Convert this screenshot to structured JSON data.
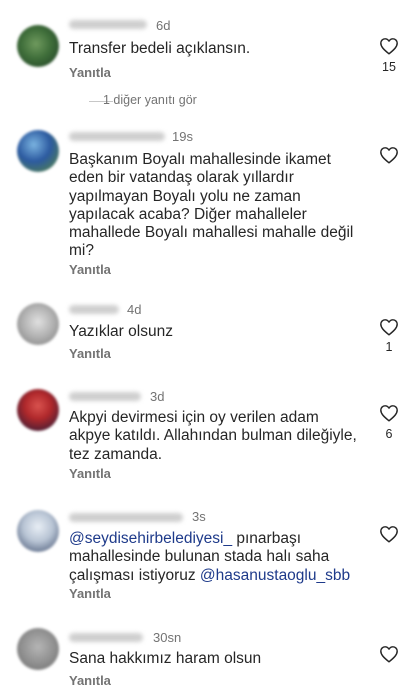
{
  "reply_label": "Yanıtla",
  "colors": {
    "text": "#262626",
    "muted": "#737373",
    "mention": "#1e3a8a"
  },
  "comments": [
    {
      "time": "6d",
      "text": "Transfer bedeli açıklansın.",
      "likes": "15",
      "avatar_colors": [
        "#3f6e3a",
        "#1c3a22"
      ]
    },
    {
      "time": "19s",
      "text": "Başkanım Boyalı mahallesinde ikamet eden bir vatandaş olarak yıllardır yapılmayan Boyalı yolu ne zaman yapılacak acaba? Diğer mahalleler mahallede Boyalı mahallesi mahalle değil mi?",
      "likes": "",
      "avatar_colors": [
        "#2c5aa0",
        "#5a8a3a"
      ]
    },
    {
      "time": "4d",
      "text": "Yazıklar olsunz",
      "likes": "1",
      "avatar_colors": [
        "#8a8a8a",
        "#d0d0d0"
      ]
    },
    {
      "time": "3d",
      "text": "Akpyi devirmesi için oy verilen adam akpye katıldı. Allahından bulman dileğiyle, tez zamanda.",
      "likes": "6",
      "avatar_colors": [
        "#b0282b",
        "#1a1a3a"
      ]
    },
    {
      "time": "3s",
      "mention1": "@seydisehirbelediyesi_",
      "text_a": " pınarbaşı mahallesinde bulunan stada halı saha çalışması istiyoruz ",
      "mention2": "@hasanustaoglu_sbb",
      "likes": "",
      "avatar_colors": [
        "#b8c4d4",
        "#3a4a6a"
      ]
    },
    {
      "time": "30sn",
      "text": "Sana hakkımız haram olsun",
      "likes": "",
      "avatar_colors": [
        "#7a7a7a",
        "#a8a8a8"
      ]
    }
  ],
  "more_replies": "1 diğer yanıtı gör"
}
